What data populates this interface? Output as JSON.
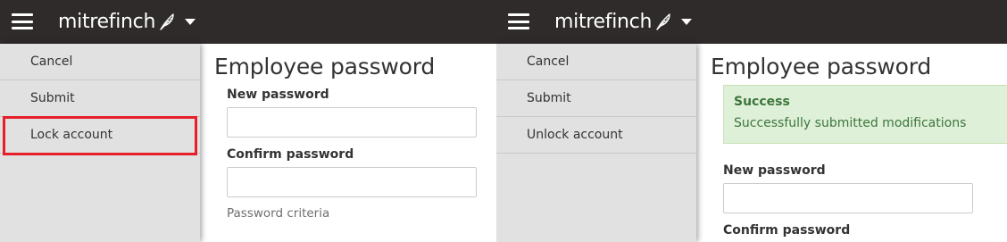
{
  "left": {
    "brand": "mitrefinch",
    "menu": [
      {
        "label": "Cancel"
      },
      {
        "label": "Submit"
      },
      {
        "label": "Lock account"
      }
    ],
    "title": "Employee password",
    "new_password_label": "New password",
    "confirm_password_label": "Confirm password",
    "criteria_link": "Password criteria"
  },
  "right": {
    "brand": "mitrefinch",
    "menu": [
      {
        "label": "Cancel"
      },
      {
        "label": "Submit"
      },
      {
        "label": "Unlock account"
      }
    ],
    "title": "Employee password",
    "alert": {
      "title": "Success",
      "message": "Successfully submitted modifications"
    },
    "new_password_label": "New password",
    "confirm_password_label": "Confirm password"
  },
  "colors": {
    "topbar": "#2e2b2a",
    "sidebar": "#e1e1e1",
    "highlight": "#e5202a",
    "success_bg": "#dff0d8",
    "success_text": "#3c763d"
  },
  "icons": [
    "hamburger-menu-icon",
    "feather-icon",
    "caret-down-icon"
  ]
}
